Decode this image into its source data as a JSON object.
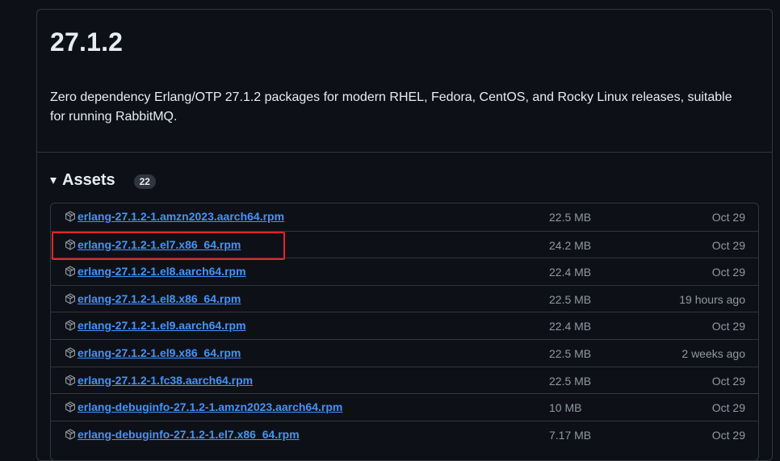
{
  "release": {
    "title": "27.1.2",
    "description": "Zero dependency Erlang/OTP 27.1.2 packages for modern RHEL, Fedora, CentOS, and Rocky Linux releases, suitable for running RabbitMQ."
  },
  "assets": {
    "label": "Assets",
    "count": "22",
    "items": [
      {
        "name": "erlang-27.1.2-1.amzn2023.aarch64.rpm",
        "size": "22.5 MB",
        "date": "Oct 29"
      },
      {
        "name": "erlang-27.1.2-1.el7.x86_64.rpm",
        "size": "24.2 MB",
        "date": "Oct 29"
      },
      {
        "name": "erlang-27.1.2-1.el8.aarch64.rpm",
        "size": "22.4 MB",
        "date": "Oct 29"
      },
      {
        "name": "erlang-27.1.2-1.el8.x86_64.rpm",
        "size": "22.5 MB",
        "date": "19 hours ago"
      },
      {
        "name": "erlang-27.1.2-1.el9.aarch64.rpm",
        "size": "22.4 MB",
        "date": "Oct 29"
      },
      {
        "name": "erlang-27.1.2-1.el9.x86_64.rpm",
        "size": "22.5 MB",
        "date": "2 weeks ago"
      },
      {
        "name": "erlang-27.1.2-1.fc38.aarch64.rpm",
        "size": "22.5 MB",
        "date": "Oct 29"
      },
      {
        "name": "erlang-debuginfo-27.1.2-1.amzn2023.aarch64.rpm",
        "size": "10 MB",
        "date": "Oct 29"
      },
      {
        "name": "erlang-debuginfo-27.1.2-1.el7.x86_64.rpm",
        "size": "7.17 MB",
        "date": "Oct 29"
      }
    ]
  },
  "icons": {
    "asset": "package-icon",
    "toggle": "triangle-down-icon"
  },
  "colors": {
    "background": "#0d1117",
    "border": "#30363d",
    "link": "#4493f8",
    "muted": "#9198a1",
    "highlight": "#e8232a"
  }
}
